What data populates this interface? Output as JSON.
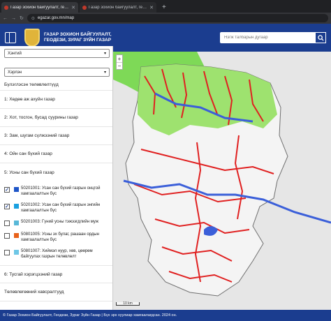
{
  "browser": {
    "tabs": [
      {
        "title": "Газар зохион байгуулалт, геодез",
        "active": true
      },
      {
        "title": "Газар зохион байгуулалт, геодез",
        "active": false
      }
    ],
    "new_tab_icon": "plus-icon",
    "url": "egazar.gov.mn/map"
  },
  "header": {
    "org_line1": "ГАЗАР ЗОХИОН БАЙГУУЛАЛТ,",
    "org_line2": "ГЕОДЕЗИ, ЗУРАГ ЗҮЙН ГАЗАР",
    "search_placeholder": "Нэгж талбарын дугаар"
  },
  "sidebar": {
    "province": "Хэнтий",
    "district": "Хэрлэн",
    "accordion": [
      "Бүлэглэсэн төлөвлөлтүүд",
      "1: Хөдөө аж ахуйн газар",
      "2: Хот, тосгон, бусад суурины газар",
      "3: Зам, шугам сүлжээний газар",
      "4: Ойн сан бүхий газар",
      "5: Усны сан бүхий газар"
    ],
    "layers": [
      {
        "code": "50201001",
        "label": "50201001: Усан сан бүхий газрын онцгой хамгаалалтын бүс",
        "checked": true,
        "color": "#1e56c8"
      },
      {
        "code": "50201002",
        "label": "50201002: Усан сан бүхий газрын энгийн хамгаалалтын бүс",
        "checked": true,
        "color": "#1aa0e0"
      },
      {
        "code": "50201003",
        "label": "50201003: Гүний усны тэжээгдлийн муж",
        "checked": false,
        "color": "#58b8d8"
      },
      {
        "code": "50801005",
        "label": "50801005: Усны эх булаг, рашаан ордын хамгаалалтын бүс",
        "checked": false,
        "color": "#e8621a"
      },
      {
        "code": "50801007",
        "label": "50801007: Хиймэл нуур, хөв, цөөрөм байгуулах газрын төлөвлөлт",
        "checked": false,
        "color": "#6ec7e6"
      }
    ],
    "accordion_after": [
      "6: Тусгай хэрэгцээний газар",
      "Төлөвлөгөөний хавсралтууд"
    ]
  },
  "map": {
    "zoom_in": "+",
    "zoom_out": "−",
    "scale_label": "10 km"
  },
  "footer": {
    "text": "© Газар Зохион Байгуулалт, Геодези, Зураг Зүйн Газар | Бүх эрх хуулиар хамгаалагдсан. 2024 он."
  },
  "colors": {
    "brand": "#1b3d8f",
    "forest": "#7ed957",
    "river_zone": "#e02020",
    "water": "#3b5fd9"
  }
}
